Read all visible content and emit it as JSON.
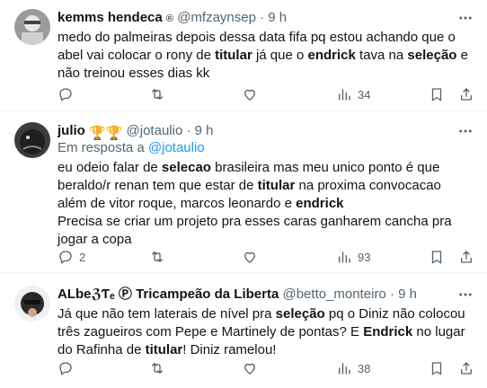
{
  "tweets": [
    {
      "name": "kemms hendeca",
      "name_badge": "®",
      "handle": "@mfzaynsep",
      "sep": "·",
      "time": "9 h",
      "text_parts": [
        "medo do palmeiras depois dessa data fifa pq estou achando que o abel vai colocar o rony de ",
        "titular",
        " já que o ",
        "endrick",
        " tava na ",
        "seleção",
        " e não treinou esses dias kk"
      ],
      "replies": "",
      "retweets": "",
      "likes": "",
      "views": "34"
    },
    {
      "name": "julio",
      "name_emoji": "🏆🏆",
      "handle": "@jotaulio",
      "sep": "·",
      "time": "9 h",
      "reply_prefix": "Em resposta a ",
      "reply_handle": "@jotaulio",
      "text_parts": [
        "eu odeio falar de ",
        "selecao",
        " brasileira mas meu unico ponto é que beraldo/r renan tem que estar de ",
        "titular",
        " na proxima convocacao além de vitor roque, marcos leonardo e ",
        "endrick"
      ],
      "text_line2": "Precisa se criar um projeto pra esses caras ganharem cancha pra jogar a copa",
      "replies": "2",
      "retweets": "",
      "likes": "",
      "views": "93"
    },
    {
      "name": "ALbeℨƬₑ Ⓟ Tricampeão da Liberta",
      "handle": "@betto_monteiro",
      "sep": "·",
      "time": "9 h",
      "text_parts": [
        "Já que não tem laterais de nível pra ",
        "seleção",
        " pq o Diniz não colocou três zagueiros com Pepe e Martinely de pontas? E ",
        "Endrick",
        " no lugar do Rafinha de ",
        "titular",
        "! Diniz ramelou!"
      ],
      "replies": "",
      "retweets": "",
      "likes": "",
      "views": "38"
    }
  ],
  "icons": {
    "more": "more-horizontal-icon",
    "reply": "reply-bubble-icon",
    "retweet": "retweet-icon",
    "like": "heart-icon",
    "views": "views-bar-chart-icon",
    "bookmark": "bookmark-icon",
    "share": "share-upload-icon"
  },
  "colors": {
    "text": "#0f1419",
    "secondary": "#536471",
    "link": "#1d9bf0",
    "divider": "#eff3f4"
  }
}
